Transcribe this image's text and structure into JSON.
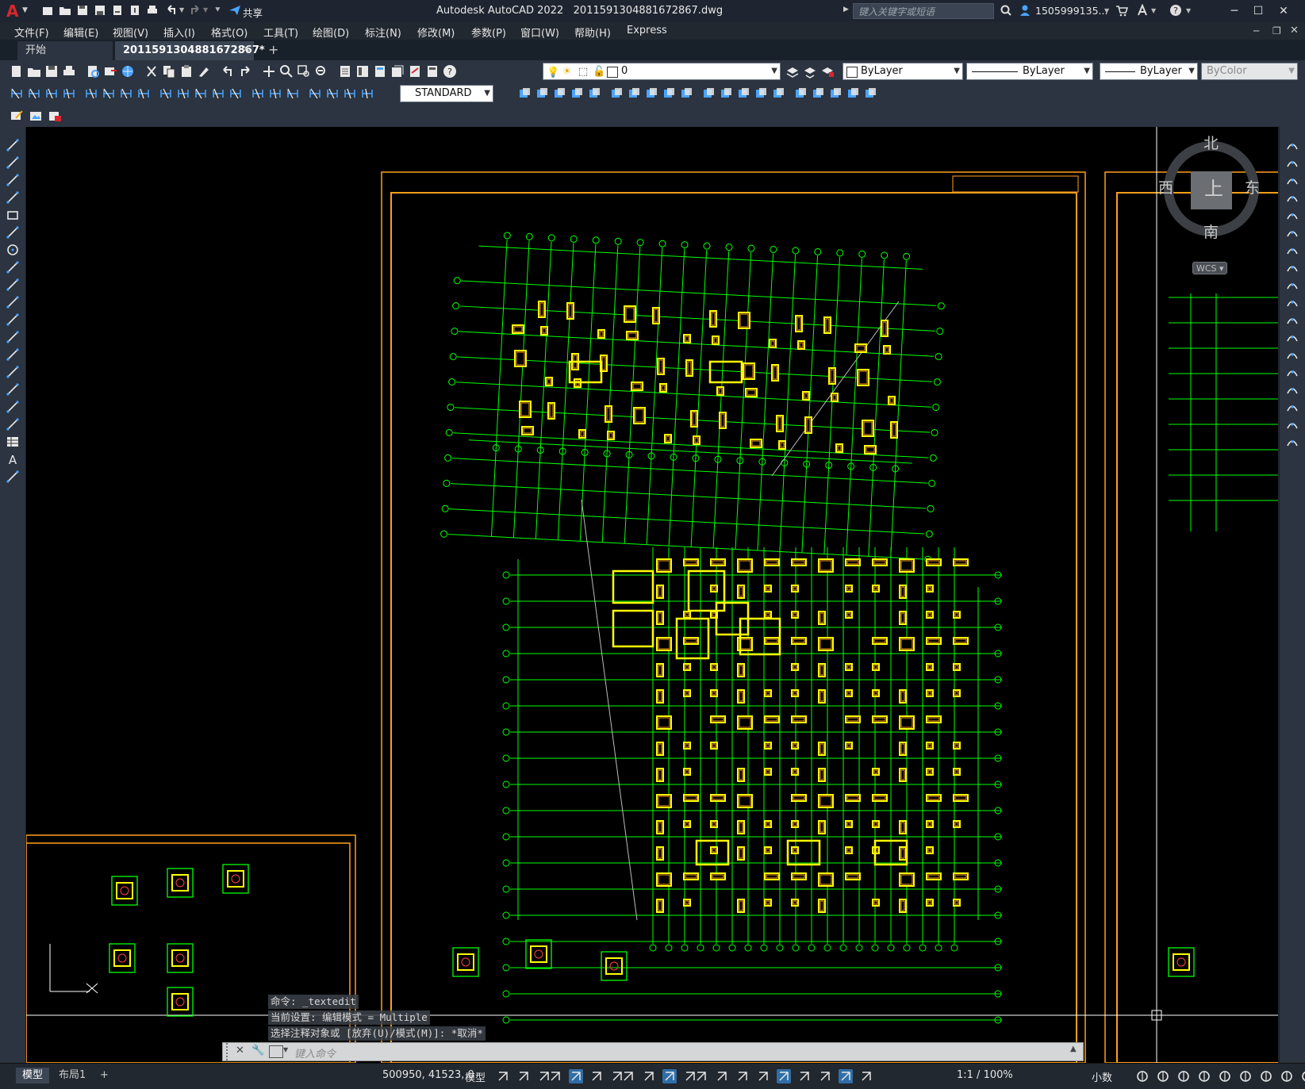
{
  "app": {
    "title": "Autodesk AutoCAD 2022",
    "filename": "2011591304881672867.dwg",
    "share_label": "共享",
    "search_placeholder": "键入关键字或短语",
    "user_name": "1505999135...",
    "logo_letter": "A"
  },
  "menu": {
    "items": [
      "文件(F)",
      "编辑(E)",
      "视图(V)",
      "插入(I)",
      "格式(O)",
      "工具(T)",
      "绘图(D)",
      "标注(N)",
      "修改(M)",
      "参数(P)",
      "窗口(W)",
      "帮助(H)",
      "Express"
    ]
  },
  "tabs": {
    "start_label": "开始",
    "doc_label": "2011591304881672867*",
    "add_label": "+"
  },
  "properties": {
    "layer_value": "0",
    "color_value": "ByLayer",
    "linetype_value": "ByLayer",
    "lineweight_value": "ByLayer",
    "plotstyle_value": "ByColor",
    "textstyle_value": "STANDARD"
  },
  "viewcube": {
    "north": "北",
    "south": "南",
    "east": "东",
    "west": "西",
    "top": "上",
    "wcs_label": "WCS"
  },
  "command": {
    "line1": "命令:  _textedit",
    "line2": "当前设置: 编辑模式 = Multiple",
    "line3": "选择注释对象或 [放弃(U)/模式(M)]: *取消*",
    "input_placeholder": "键入命令"
  },
  "statusbar": {
    "model_tab": "模型",
    "layout_tab": "布局1",
    "add_tab": "+",
    "coordinates": "500950, 41523, 0",
    "space_label": "模型",
    "scale_label": "1:1 / 100%",
    "units_label": "小数"
  },
  "colors": {
    "accent_red": "#d9262c",
    "drawing_green": "#00ff00",
    "drawing_yellow": "#ffff00",
    "frame_orange": "#ff9f1a",
    "canvas_bg": "#000000",
    "ui_bg": "#212830"
  }
}
